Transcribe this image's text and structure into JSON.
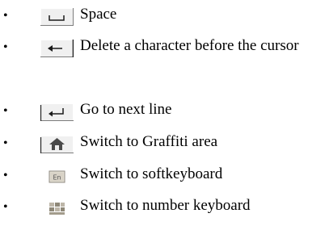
{
  "bullets": {
    "symbol": "•"
  },
  "items": [
    {
      "icon": "space-key-icon",
      "label": "Space"
    },
    {
      "icon": "backspace-key-icon",
      "label": "Delete a character before the cursor"
    },
    {
      "icon": "enter-key-icon",
      "label": "Go to next line"
    },
    {
      "icon": "home-key-icon",
      "label": "Switch to Graffiti area"
    },
    {
      "icon": "en-keyboard-icon",
      "label": "Switch to softkeyboard"
    },
    {
      "icon": "number-keyboard-icon",
      "label": "Switch to number keyboard"
    }
  ]
}
